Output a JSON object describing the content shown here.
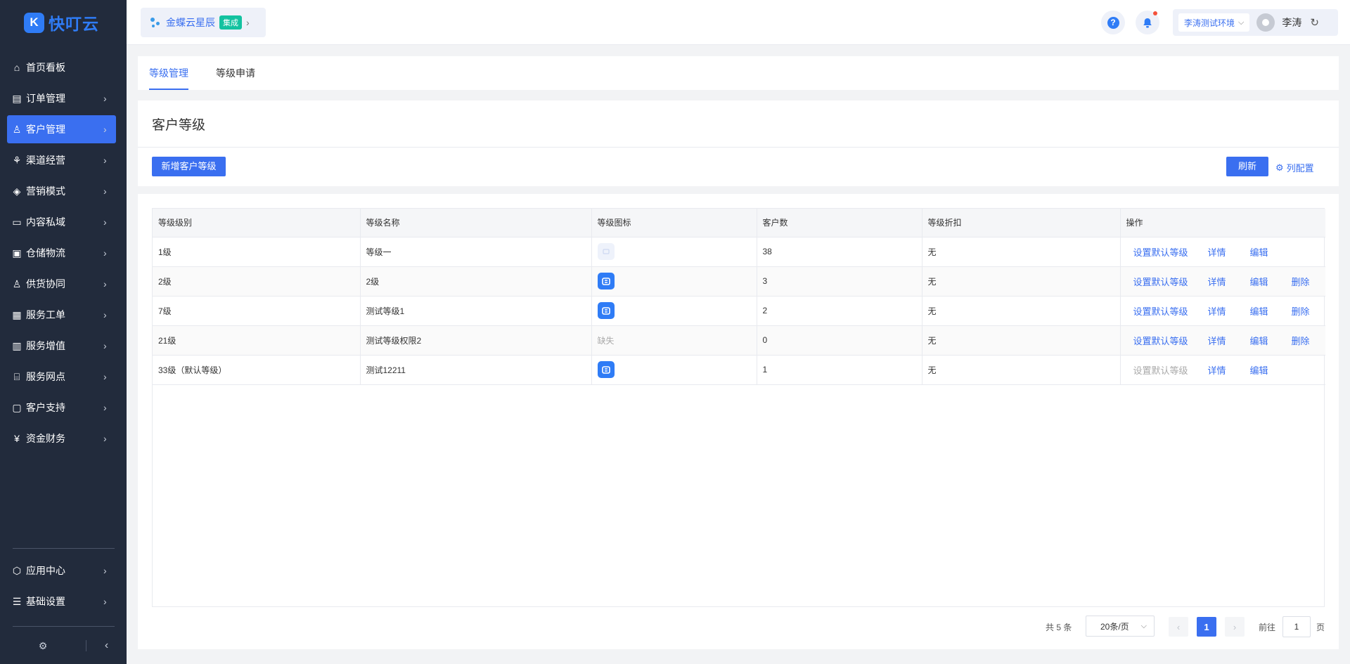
{
  "brand": {
    "logo_glyph": "K",
    "name": "快叮云"
  },
  "menu": [
    {
      "label": "首页看板",
      "icon": "⌂",
      "has_chevron": false,
      "active": false
    },
    {
      "label": "订单管理",
      "icon": "▤",
      "has_chevron": true,
      "active": false
    },
    {
      "label": "客户管理",
      "icon": "♙",
      "has_chevron": true,
      "active": true
    },
    {
      "label": "渠道经营",
      "icon": "⚘",
      "has_chevron": true,
      "active": false
    },
    {
      "label": "营销模式",
      "icon": "◈",
      "has_chevron": true,
      "active": false
    },
    {
      "label": "内容私域",
      "icon": "▭",
      "has_chevron": true,
      "active": false
    },
    {
      "label": "仓储物流",
      "icon": "▣",
      "has_chevron": true,
      "active": false
    },
    {
      "label": "供货协同",
      "icon": "♙",
      "has_chevron": true,
      "active": false
    },
    {
      "label": "服务工单",
      "icon": "▦",
      "has_chevron": true,
      "active": false
    },
    {
      "label": "服务增值",
      "icon": "▥",
      "has_chevron": true,
      "active": false
    },
    {
      "label": "服务网点",
      "icon": "⌸",
      "has_chevron": true,
      "active": false
    },
    {
      "label": "客户支持",
      "icon": "▢",
      "has_chevron": true,
      "active": false
    },
    {
      "label": "资金财务",
      "icon": "¥",
      "has_chevron": true,
      "active": false
    }
  ],
  "menu_bottom": [
    {
      "label": "应用中心",
      "icon": "⬡",
      "has_chevron": true
    },
    {
      "label": "基础设置",
      "icon": "☰",
      "has_chevron": true
    }
  ],
  "sidebar_footer": {
    "settings_icon": "⚙",
    "collapse_icon": "‹"
  },
  "topbar": {
    "integration_name": "金蝶云星辰",
    "integration_tag": "集成",
    "env_name": "李涛测试环境",
    "user_name": "李涛"
  },
  "tabs": [
    {
      "label": "等级管理",
      "active": true
    },
    {
      "label": "等级申请",
      "active": false
    }
  ],
  "page": {
    "title": "客户等级",
    "add_button": "新增客户等级",
    "refresh_button": "刷新",
    "column_config": "列配置"
  },
  "table": {
    "columns": [
      "等级级别",
      "等级名称",
      "等级图标",
      "客户数",
      "等级折扣",
      "操作"
    ],
    "rows": [
      {
        "level": "1级",
        "name": "等级一",
        "icon": "faint",
        "icon_text": "",
        "customers": "38",
        "discount": "无",
        "default_enabled": true,
        "deletable": false
      },
      {
        "level": "2级",
        "name": "2级",
        "icon": "blue",
        "icon_text": "",
        "customers": "3",
        "discount": "无",
        "default_enabled": true,
        "deletable": true
      },
      {
        "level": "7级",
        "name": "测试等级1",
        "icon": "blue",
        "icon_text": "",
        "customers": "2",
        "discount": "无",
        "default_enabled": true,
        "deletable": true
      },
      {
        "level": "21级",
        "name": "测试等级权限2",
        "icon": "missing",
        "icon_text": "缺失",
        "customers": "0",
        "discount": "无",
        "default_enabled": true,
        "deletable": true
      },
      {
        "level": "33级（默认等级）",
        "name": "测试12211",
        "icon": "blue",
        "icon_text": "",
        "customers": "1",
        "discount": "无",
        "default_enabled": false,
        "deletable": false
      }
    ],
    "actions": {
      "set_default": "设置默认等级",
      "detail": "详情",
      "edit": "编辑",
      "delete": "删除"
    }
  },
  "pagination": {
    "total": "共 5 条",
    "page_size": "20条/页",
    "current_page": "1",
    "goto_label": "前往",
    "goto_value": "1",
    "goto_suffix": "页"
  },
  "colors": {
    "primary": "#3a6ff0",
    "sidebar_bg": "#222b3c",
    "tag_green": "#13c2a0",
    "badge_red": "#f4513a"
  }
}
